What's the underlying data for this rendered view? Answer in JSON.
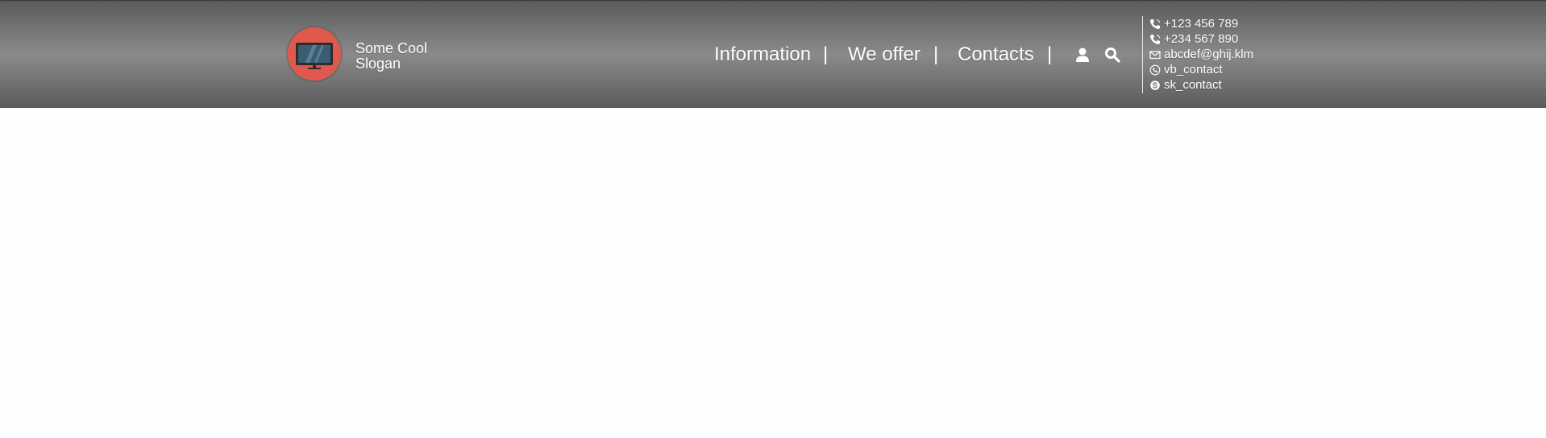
{
  "brand": {
    "slogan_line1": "Some Cool",
    "slogan_line2": "Slogan",
    "logo_icon": "monitor-icon",
    "logo_color": "#e0594c"
  },
  "nav": {
    "items": [
      {
        "label": "Information"
      },
      {
        "label": "We offer"
      },
      {
        "label": "Contacts"
      }
    ],
    "separator": "|"
  },
  "tools": {
    "user_icon": "user-icon",
    "search_icon": "search-icon"
  },
  "contacts": {
    "phone1": "+123 456 789",
    "phone2": "+234 567 890",
    "email": "abcdef@ghij.klm",
    "viber": "vb_contact",
    "skype": "sk_contact"
  },
  "colors": {
    "header_gradient_dark": "#5a5a5a",
    "header_gradient_light": "#8a8a8a",
    "text": "#ffffff",
    "page_background": "#fefefe"
  }
}
